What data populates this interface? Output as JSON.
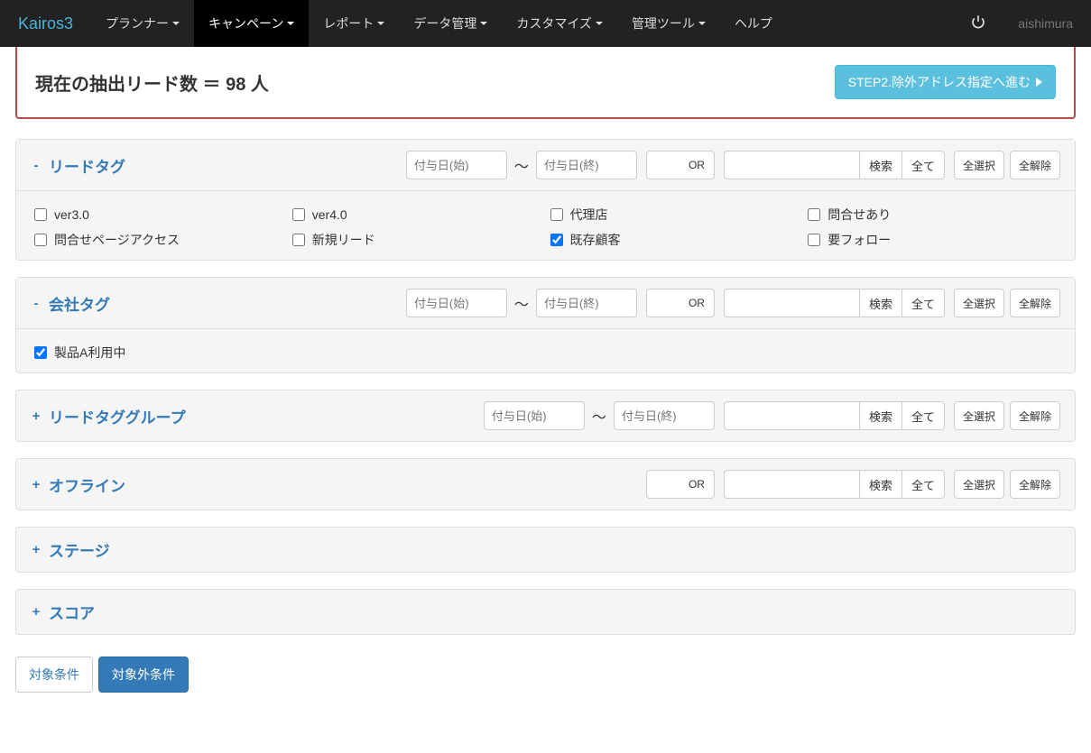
{
  "brand": "Kairos3",
  "nav": {
    "items": [
      {
        "label": "プランナー",
        "dropdown": true
      },
      {
        "label": "キャンペーン",
        "dropdown": true,
        "active": true
      },
      {
        "label": "レポート",
        "dropdown": true
      },
      {
        "label": "データ管理",
        "dropdown": true
      },
      {
        "label": "カスタマイズ",
        "dropdown": true
      },
      {
        "label": "管理ツール",
        "dropdown": true
      },
      {
        "label": "ヘルプ",
        "dropdown": false
      }
    ]
  },
  "user": "aishimura",
  "leadCount": {
    "text": "現在の抽出リード数 ＝ 98 人"
  },
  "stepButton": "STEP2.除外アドレス指定へ進む",
  "labels": {
    "dateStartPH": "付与日(始)",
    "dateEndPH": "付与日(終)",
    "or": "OR",
    "search": "検索",
    "all": "全て",
    "selectAll": "全選択",
    "deselectAll": "全解除"
  },
  "panels": {
    "leadTag": {
      "title": "リードタグ",
      "sign": "-",
      "expanded": true,
      "hasDates": true,
      "hasOr": true,
      "hasSearch": true,
      "hasSelect": true,
      "options": [
        {
          "label": "ver3.0",
          "checked": false
        },
        {
          "label": "ver4.0",
          "checked": false
        },
        {
          "label": "代理店",
          "checked": false
        },
        {
          "label": "問合せあり",
          "checked": false
        },
        {
          "label": "問合せページアクセス",
          "checked": false
        },
        {
          "label": "新規リード",
          "checked": false
        },
        {
          "label": "既存顧客",
          "checked": true
        },
        {
          "label": "要フォロー",
          "checked": false
        }
      ]
    },
    "companyTag": {
      "title": "会社タグ",
      "sign": "-",
      "expanded": true,
      "hasDates": true,
      "hasOr": true,
      "hasSearch": true,
      "hasSelect": true,
      "options": [
        {
          "label": "製品A利用中",
          "checked": true
        }
      ]
    },
    "leadTagGroup": {
      "title": "リードタググループ",
      "sign": "+",
      "expanded": false,
      "hasDates": true,
      "hasOr": false,
      "hasSearch": true,
      "hasSelect": true
    },
    "offline": {
      "title": "オフライン",
      "sign": "+",
      "expanded": false,
      "hasDates": false,
      "hasOr": true,
      "hasSearch": true,
      "hasSelect": true
    },
    "stage": {
      "title": "ステージ",
      "sign": "+",
      "expanded": false,
      "hasDates": false,
      "hasOr": false,
      "hasSearch": false,
      "hasSelect": false
    },
    "score": {
      "title": "スコア",
      "sign": "+",
      "expanded": false,
      "hasDates": false,
      "hasOr": false,
      "hasSearch": false,
      "hasSelect": false
    }
  },
  "tabs": {
    "include": "対象条件",
    "exclude": "対象外条件",
    "active": "exclude"
  }
}
